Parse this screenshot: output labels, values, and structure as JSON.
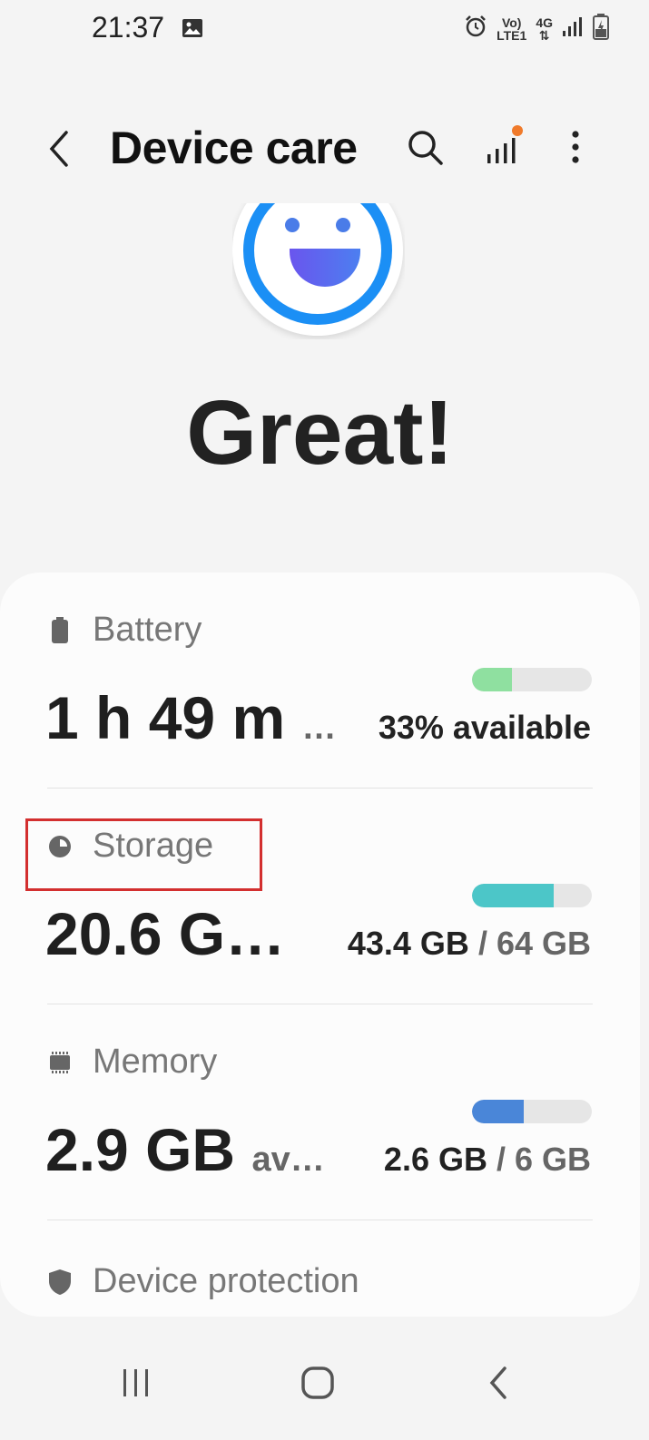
{
  "status_bar": {
    "time": "21:37",
    "volte": "Vo)",
    "lte": "LTE1",
    "network": "4G"
  },
  "app_bar": {
    "title": "Device care"
  },
  "status": {
    "heading": "Great!"
  },
  "sections": [
    {
      "label": "Battery",
      "value": "1 h 49 m",
      "suffix": "…",
      "detail": "33% available",
      "detail_primary": "33% available",
      "detail_secondary": "",
      "level": 0.33,
      "color": "#8fe0a0"
    },
    {
      "label": "Storage",
      "value": "20.6 G…",
      "suffix": "",
      "detail_primary": "43.4 GB",
      "detail_secondary": " / 64 GB",
      "level": 0.68,
      "color": "#4cc6c8"
    },
    {
      "label": "Memory",
      "value": "2.9 GB",
      "suffix": "av…",
      "detail_primary": "2.6 GB",
      "detail_secondary": " / 6 GB",
      "level": 0.43,
      "color": "#4a86d8"
    },
    {
      "label": "Device protection"
    }
  ],
  "colors": {
    "accent": "#1b8ff5",
    "highlight": "#d32f2f",
    "notification_dot": "#f07a2a"
  }
}
